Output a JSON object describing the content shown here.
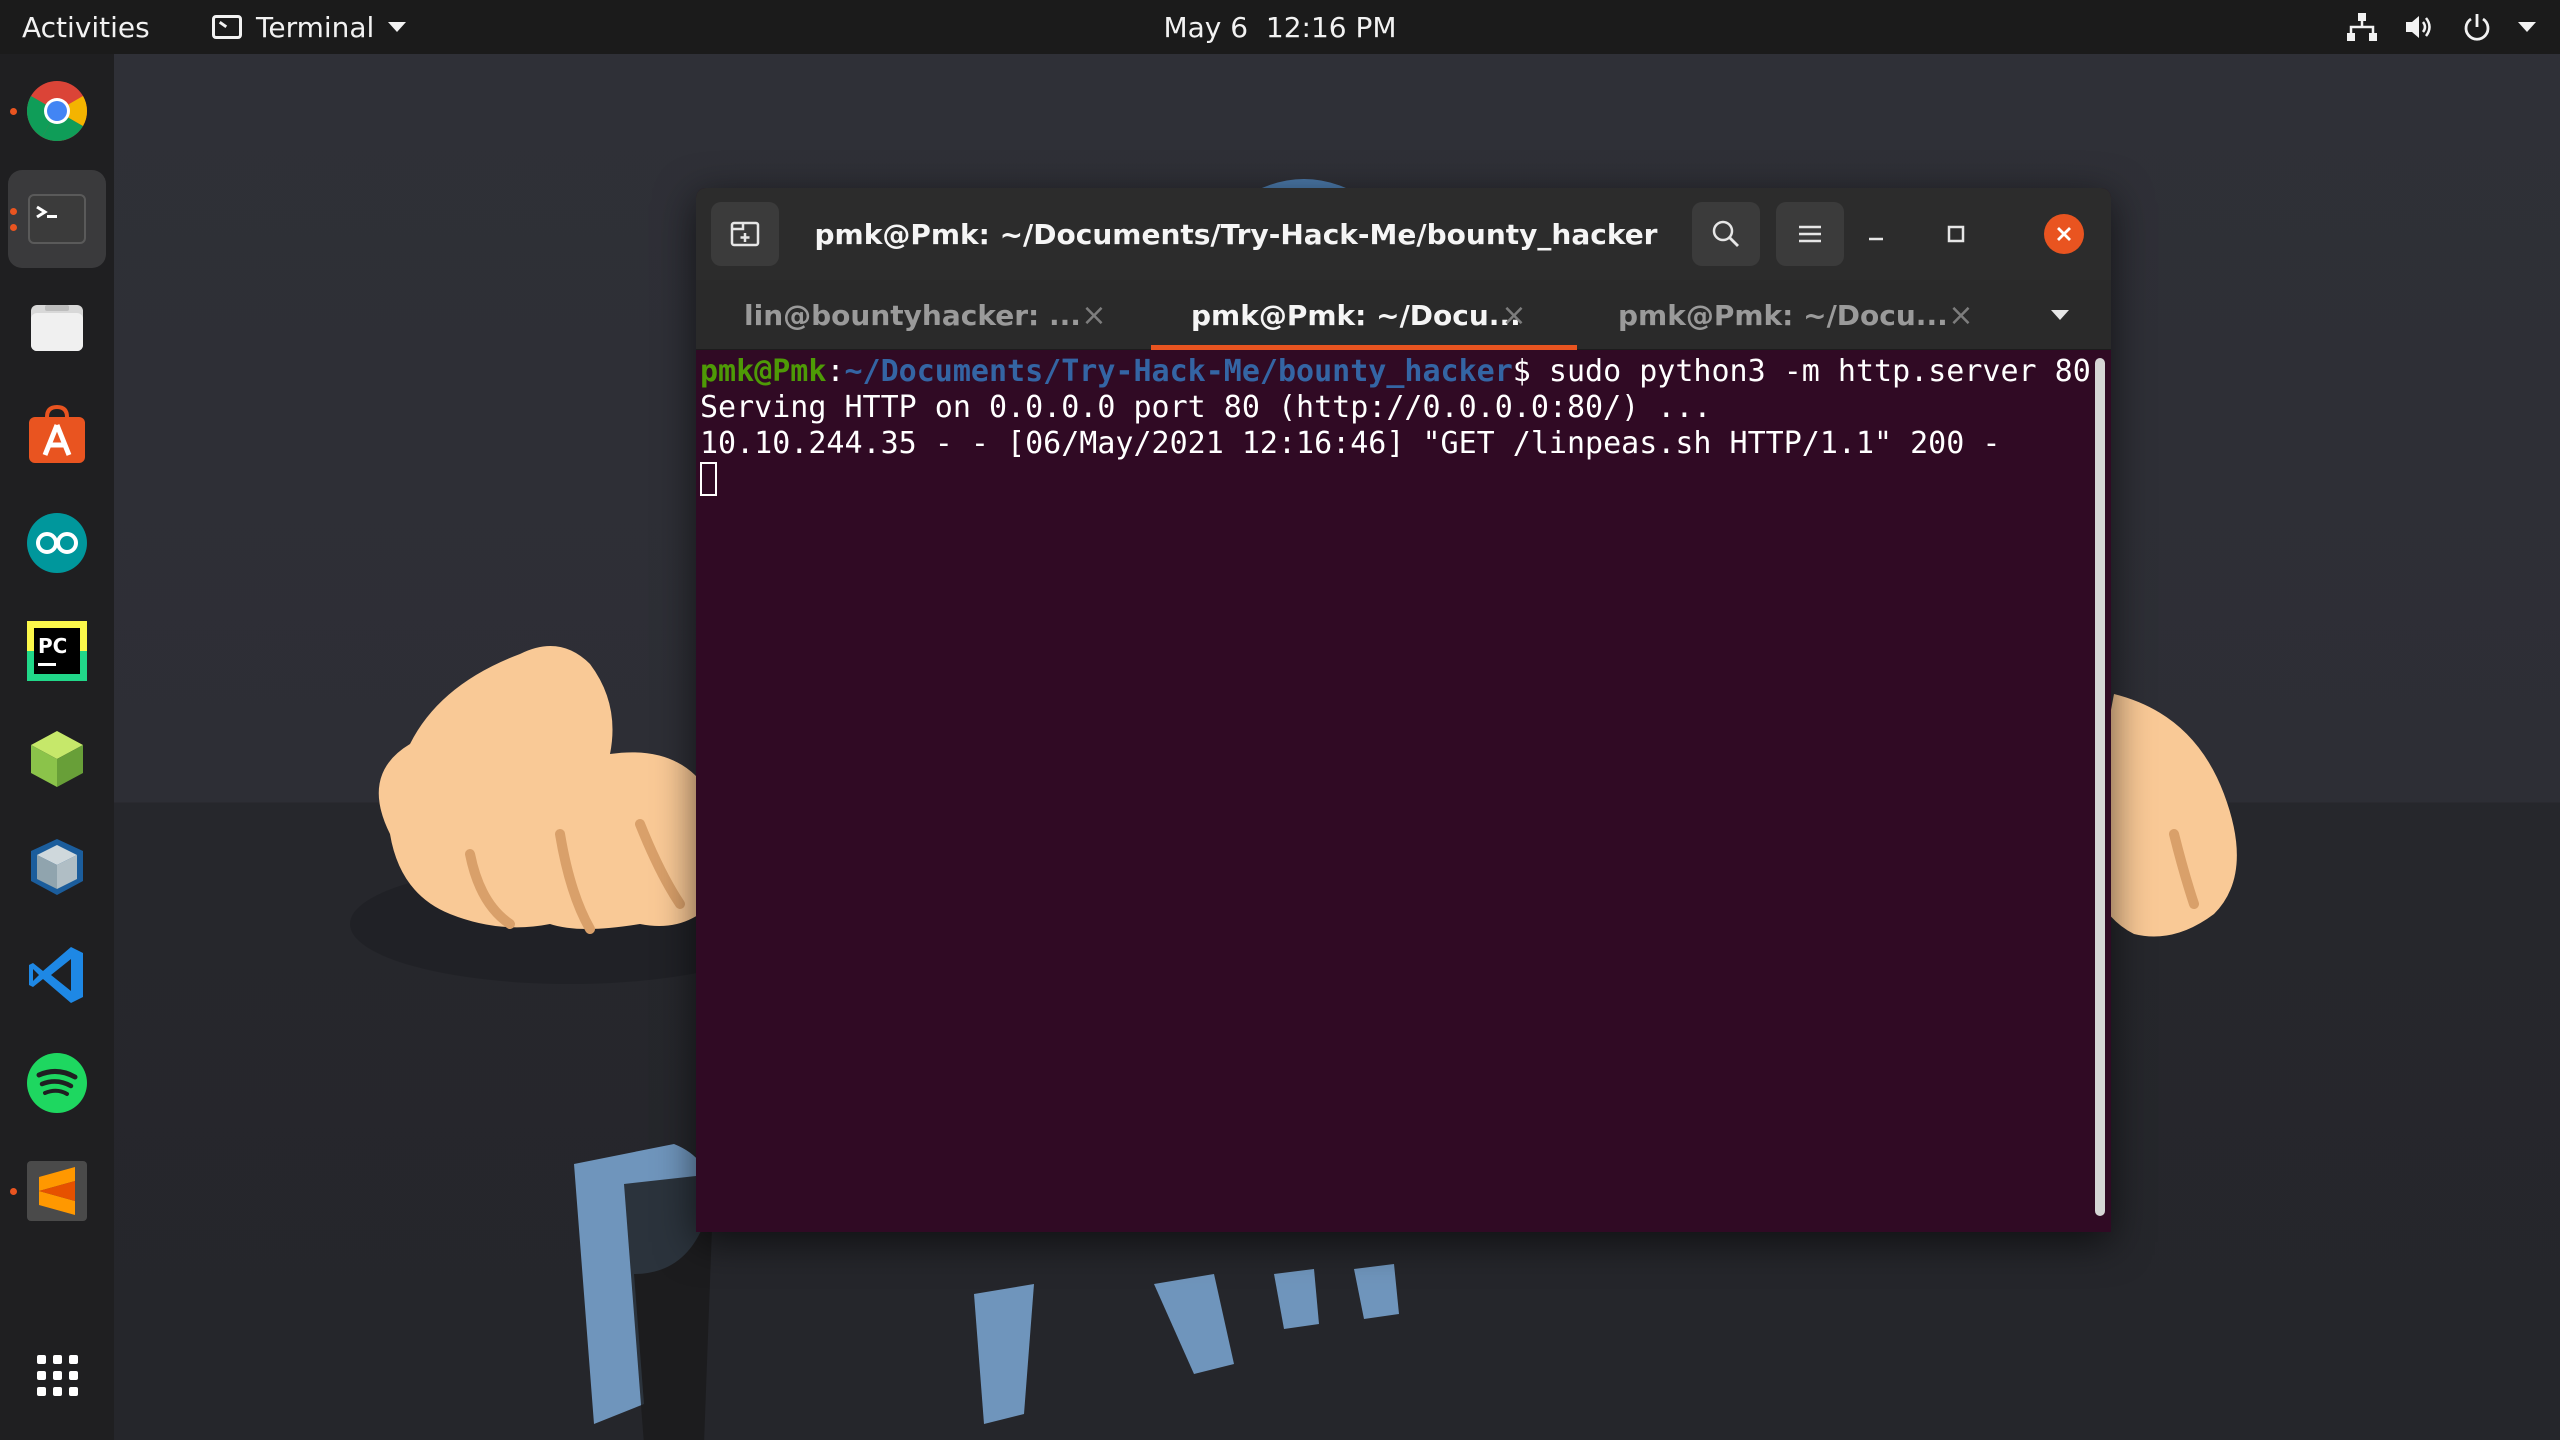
{
  "topbar": {
    "activities_label": "Activities",
    "app_menu_label": "Terminal",
    "clock_date": "May 6",
    "clock_time": "12:16 PM",
    "status_icons": [
      "network-icon",
      "volume-icon",
      "power-icon"
    ]
  },
  "dock": {
    "items": [
      {
        "name": "Google Chrome",
        "icon": "chrome-icon",
        "running": true
      },
      {
        "name": "Terminal",
        "icon": "terminal-icon",
        "running": true,
        "active": true
      },
      {
        "name": "Files",
        "icon": "files-icon",
        "running": false
      },
      {
        "name": "Ubuntu Software",
        "icon": "software-icon",
        "running": false
      },
      {
        "name": "Arduino IDE",
        "icon": "arduino-icon",
        "running": false
      },
      {
        "name": "PyCharm",
        "icon": "pycharm-icon",
        "running": false
      },
      {
        "name": "Cube",
        "icon": "cube-icon",
        "running": false
      },
      {
        "name": "VirtualBox",
        "icon": "virtualbox-icon",
        "running": false
      },
      {
        "name": "Visual Studio Code",
        "icon": "vscode-icon",
        "running": false
      },
      {
        "name": "Spotify",
        "icon": "spotify-icon",
        "running": false
      },
      {
        "name": "Sublime Text",
        "icon": "sublime-icon",
        "running": true
      }
    ],
    "show_apps_icon": "grid-icon"
  },
  "window": {
    "title": "pmk@Pmk: ~/Documents/Try-Hack-Me/bounty_hacker",
    "tabs": [
      {
        "label": "lin@bountyhacker: ...",
        "active": false
      },
      {
        "label": "pmk@Pmk: ~/Docu...",
        "active": true
      },
      {
        "label": "pmk@Pmk: ~/Docu...",
        "active": false
      }
    ],
    "tab_close_glyph": "×"
  },
  "terminal": {
    "prompt_user": "pmk@Pmk",
    "prompt_sep": ":",
    "prompt_path": "~/Documents/Try-Hack-Me/bounty_hacker",
    "prompt_symbol": "$",
    "command": " sudo python3 -m http.server 80",
    "output": [
      "Serving HTTP on 0.0.0.0 port 80 (http://0.0.0.0:80/) ...",
      "10.10.244.35 - - [06/May/2021 12:16:46] \"GET /linpeas.sh HTTP/1.1\" 200 -"
    ]
  },
  "colors": {
    "accent": "#e95420",
    "terminal_bg": "#300a24",
    "prompt_user": "#4e9a06",
    "prompt_path": "#3465a4"
  }
}
